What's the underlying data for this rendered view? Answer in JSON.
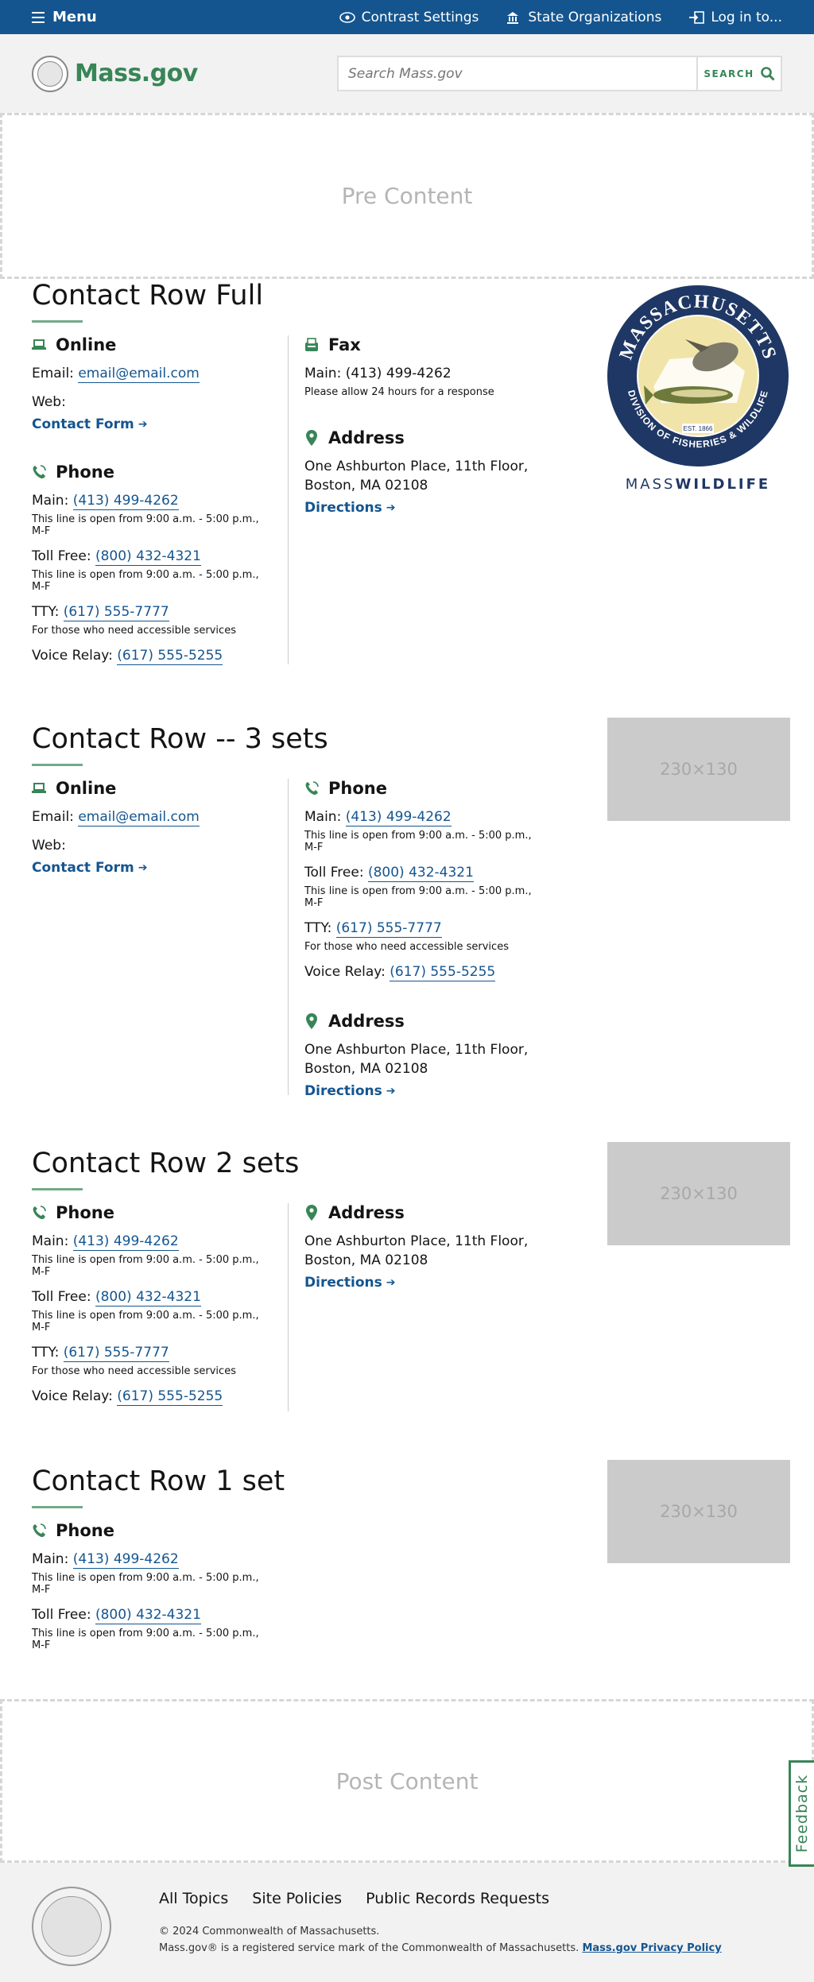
{
  "topbar": {
    "menu_label": "Menu",
    "contrast_label": "Contrast Settings",
    "state_orgs_label": "State Organizations",
    "login_label": "Log in to..."
  },
  "header": {
    "logo_text": "Mass.gov",
    "search_placeholder": "Search Mass.gov",
    "search_button": "SEARCH"
  },
  "pre_content": "Pre Content",
  "post_content": "Post Content",
  "common": {
    "online_heading": "Online",
    "phone_heading": "Phone",
    "fax_heading": "Fax",
    "address_heading": "Address",
    "email_label": "Email:",
    "email_value": "email@email.com",
    "web_label": "Web:",
    "contact_form": "Contact Form",
    "main_label": "Main:",
    "main_value": "(413) 499-4262",
    "main_note": "This line is open from 9:00 a.m. - 5:00 p.m., M-F",
    "tollfree_label": "Toll Free:",
    "tollfree_value": "(800) 432-4321",
    "tollfree_note": "This line is open from 9:00 a.m. - 5:00 p.m., M-F",
    "tty_label": "TTY:",
    "tty_value": "(617) 555-7777",
    "tty_note": "For those who need accessible services",
    "relay_label": "Voice Relay:",
    "relay_value": "(617) 555-5255",
    "fax_main_label": "Main:",
    "fax_value": "(413) 499-4262",
    "fax_note": "Please allow 24 hours for a response",
    "address_line1": "One Ashburton Place, 11th Floor,",
    "address_line2": "Boston, MA 02108",
    "directions": "Directions"
  },
  "sections": [
    {
      "title": "Contact Row Full"
    },
    {
      "title": "Contact Row -- 3 sets"
    },
    {
      "title": "Contact Row 2 sets"
    },
    {
      "title": "Contact Row 1 set"
    }
  ],
  "image_placeholder": "230×130",
  "masswildlife": {
    "ring_top": "MASSACHUSETTS",
    "ring_bottom": "DIVISION OF FISHERIES & WILDLIFE",
    "est": "EST. 1866",
    "caption_light": "MASS",
    "caption_bold": "WILDLIFE"
  },
  "footer": {
    "links": [
      "All Topics",
      "Site Policies",
      "Public Records Requests"
    ],
    "copyright": "© 2024 Commonwealth of Massachusetts.",
    "trademark": "Mass.gov® is a registered service mark of the Commonwealth of Massachusetts.",
    "privacy": "Mass.gov Privacy Policy"
  },
  "feedback": "Feedback",
  "colors": {
    "brand_blue": "#14558f",
    "brand_green": "#388557",
    "navy": "#1f3764"
  }
}
